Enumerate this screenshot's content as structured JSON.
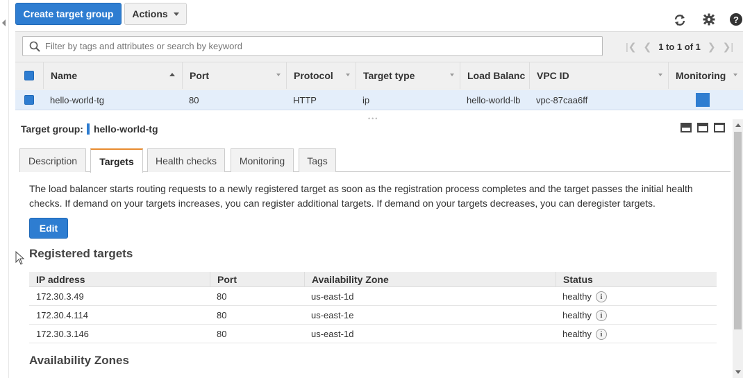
{
  "toolbar": {
    "create_label": "Create target group",
    "actions_label": "Actions",
    "icons": [
      "refresh-icon",
      "gear-icon",
      "help-icon"
    ]
  },
  "filter": {
    "placeholder": "Filter by tags and attributes or search by keyword",
    "pagination": "1 to 1 of 1"
  },
  "grid": {
    "columns": [
      "Name",
      "Port",
      "Protocol",
      "Target type",
      "Load Balanc",
      "VPC ID",
      "Monitoring"
    ],
    "rows": [
      {
        "name": "hello-world-tg",
        "port": "80",
        "protocol": "HTTP",
        "target_type": "ip",
        "load_balancer": "hello-world-lb",
        "vpc_id": "vpc-87caa6ff"
      }
    ]
  },
  "detail": {
    "label": "Target group:",
    "name": "hello-world-tg",
    "tabs": [
      "Description",
      "Targets",
      "Health checks",
      "Monitoring",
      "Tags"
    ],
    "active_tab": "Targets",
    "description": "The load balancer starts routing requests to a newly registered target as soon as the registration process completes and the target passes the initial health checks. If demand on your targets increases, you can register additional targets. If demand on your targets decreases, you can deregister targets.",
    "edit_label": "Edit",
    "registered_heading": "Registered targets",
    "az_heading": "Availability Zones",
    "targets_columns": [
      "IP address",
      "Port",
      "Availability Zone",
      "Status"
    ],
    "targets": [
      {
        "ip": "172.30.3.49",
        "port": "80",
        "zone": "us-east-1d",
        "status": "healthy"
      },
      {
        "ip": "172.30.4.114",
        "port": "80",
        "zone": "us-east-1e",
        "status": "healthy"
      },
      {
        "ip": "172.30.3.146",
        "port": "80",
        "zone": "us-east-1d",
        "status": "healthy"
      }
    ]
  },
  "colors": {
    "primary": "#2e7dd1",
    "active_tab_accent": "#e88b2e",
    "selected_row": "#e4eefa"
  }
}
